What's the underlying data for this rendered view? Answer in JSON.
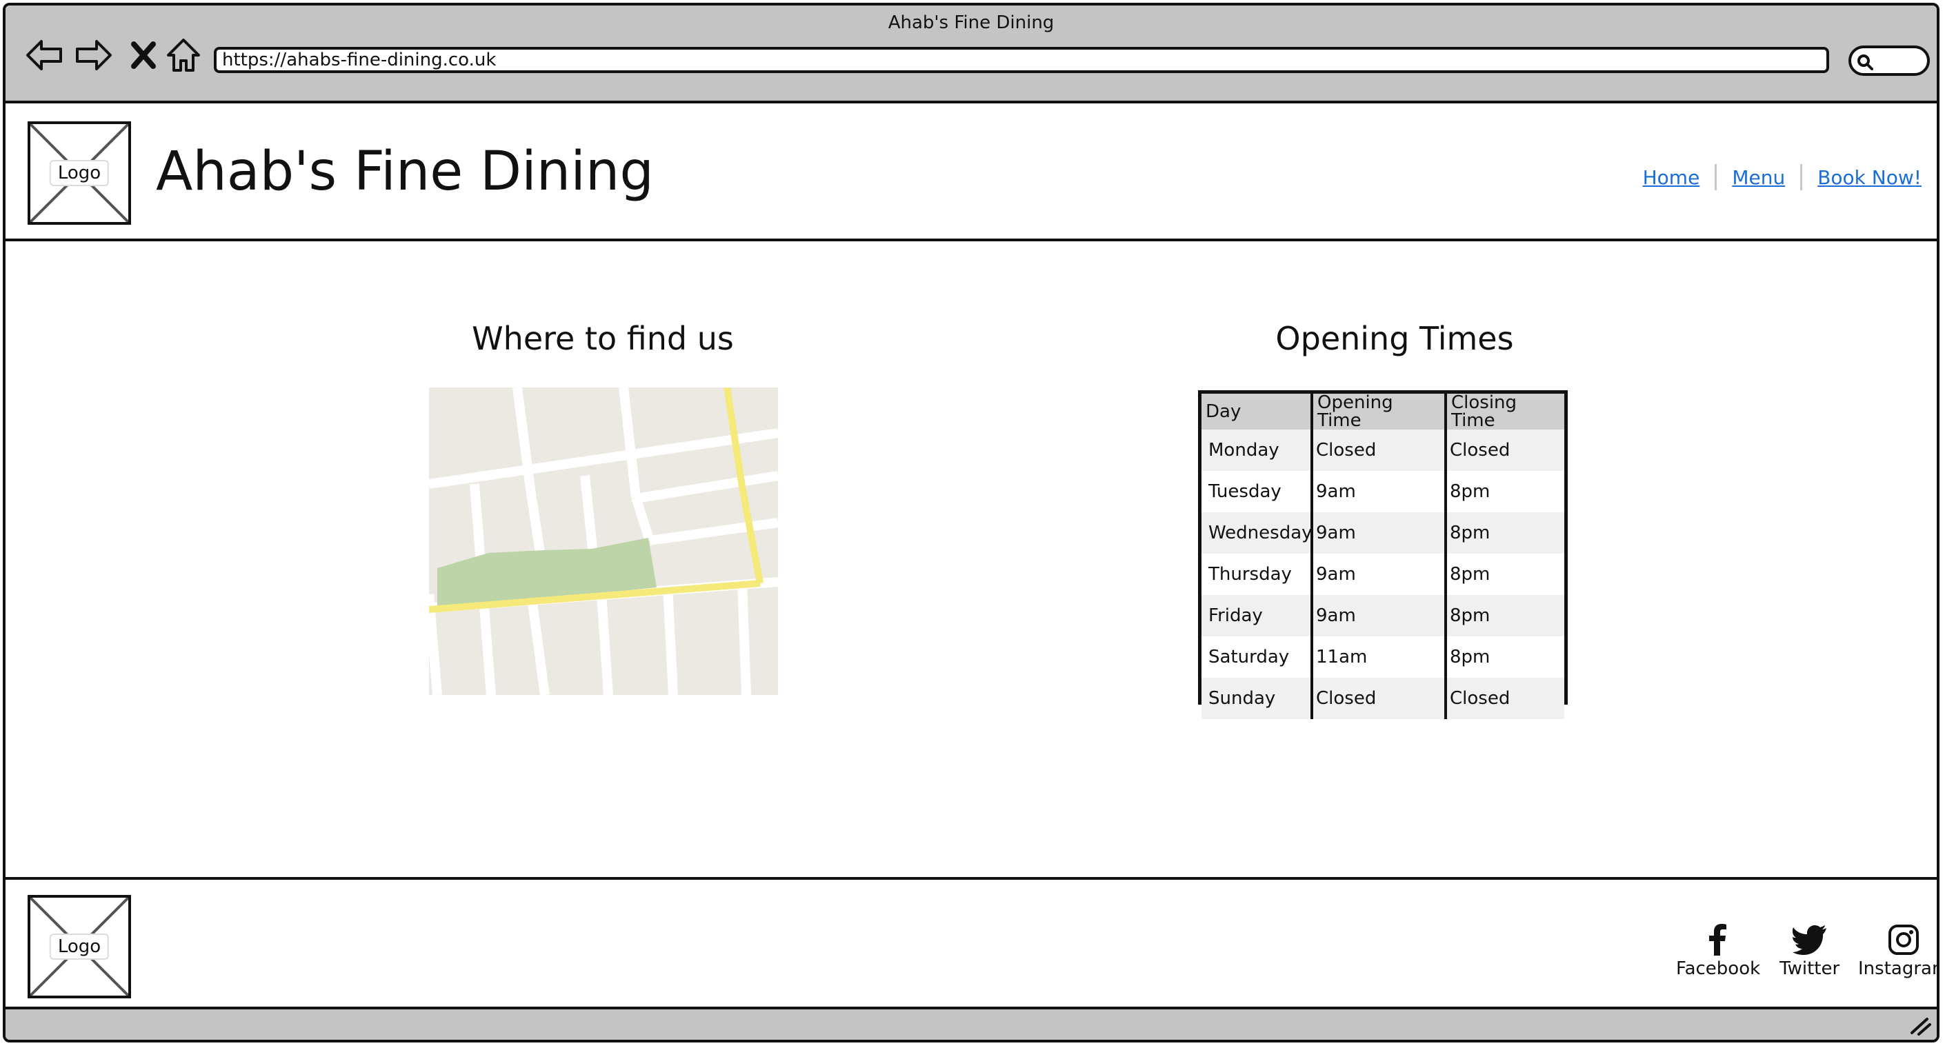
{
  "window": {
    "title": "Ahab's Fine Dining",
    "url": "https://ahabs-fine-dining.co.uk"
  },
  "header": {
    "logo_label": "Logo",
    "site_title": "Ahab's Fine Dining",
    "nav": [
      "Home",
      "Menu",
      "Book Now!"
    ]
  },
  "location": {
    "title": "Where to find us"
  },
  "opening_times": {
    "title": "Opening Times",
    "columns": [
      "Day",
      "Opening Time",
      "Closing Time"
    ],
    "rows": [
      [
        "Monday",
        "Closed",
        "Closed"
      ],
      [
        "Tuesday",
        "9am",
        "8pm"
      ],
      [
        "Wednesday",
        "9am",
        "8pm"
      ],
      [
        "Thursday",
        "9am",
        "8pm"
      ],
      [
        "Friday",
        "9am",
        "8pm"
      ],
      [
        "Saturday",
        "11am",
        "8pm"
      ],
      [
        "Sunday",
        "Closed",
        "Closed"
      ]
    ]
  },
  "footer": {
    "logo_label": "Logo",
    "social": [
      "Facebook",
      "Twitter",
      "Instagram"
    ]
  },
  "icons": {
    "back": "back-arrow-icon",
    "forward": "forward-arrow-icon",
    "stop": "stop-x-icon",
    "home": "home-icon",
    "search": "search-icon",
    "facebook": "facebook-icon",
    "twitter": "twitter-icon",
    "instagram": "instagram-icon",
    "resize": "resize-grip-icon"
  },
  "colors": {
    "link": "#1b6ed6",
    "chrome": "#c4c4c4",
    "map_background": "#ebe9e2",
    "map_road_major": "#f5e97a",
    "map_park": "#bcd4a8"
  }
}
